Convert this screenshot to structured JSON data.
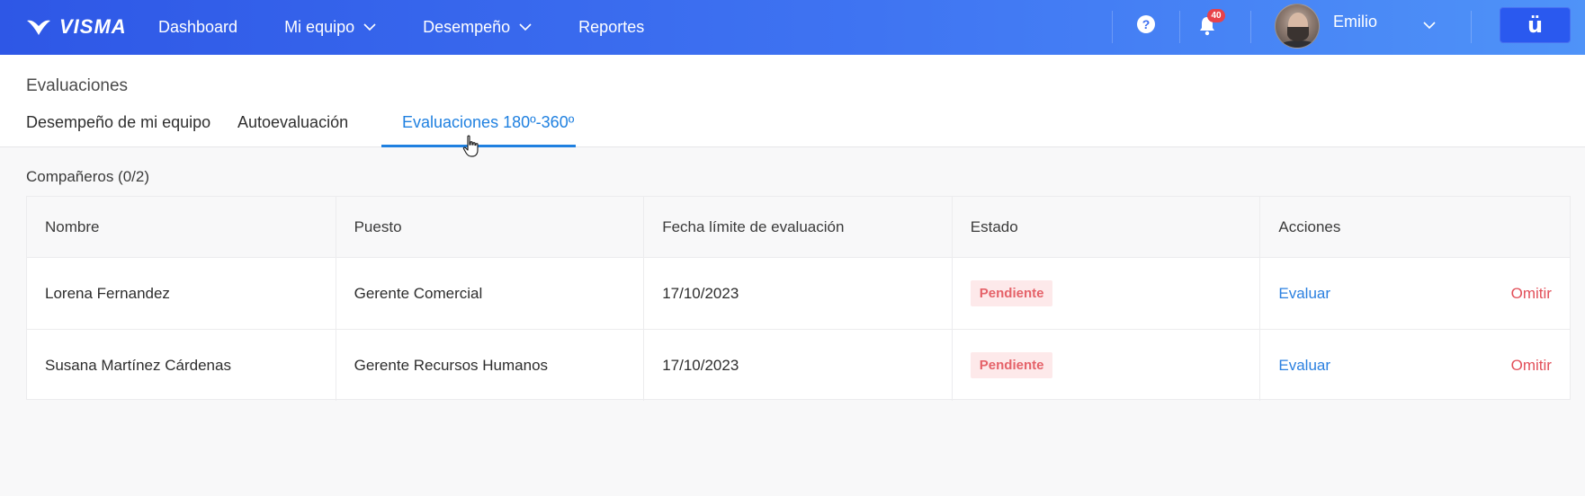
{
  "brand": {
    "name": "VISMA"
  },
  "nav": {
    "items": [
      {
        "label": "Dashboard",
        "has_dropdown": false
      },
      {
        "label": "Mi equipo",
        "has_dropdown": true
      },
      {
        "label": "Desempeño",
        "has_dropdown": true
      },
      {
        "label": "Reportes",
        "has_dropdown": false
      }
    ],
    "help_icon": "?",
    "notifications_count": "40",
    "user_name": "Emilio",
    "app_icon": "ü"
  },
  "page": {
    "title": "Evaluaciones",
    "tabs": [
      {
        "label": "Desempeño de mi equipo",
        "active": false
      },
      {
        "label": "Autoevaluación",
        "active": false
      },
      {
        "label": "Evaluaciones 180º-360º",
        "active": true
      }
    ]
  },
  "section": {
    "title": "Compañeros (0/2)"
  },
  "table": {
    "columns": [
      "Nombre",
      "Puesto",
      "Fecha límite de evaluación",
      "Estado",
      "Acciones"
    ],
    "rows": [
      {
        "name": "Lorena Fernandez",
        "position": "Gerente Comercial",
        "deadline": "17/10/2023",
        "status": "Pendiente",
        "action_primary": "Evaluar",
        "action_secondary": "Omitir"
      },
      {
        "name": "Susana Martínez Cárdenas",
        "position": "Gerente Recursos Humanos",
        "deadline": "17/10/2023",
        "status": "Pendiente",
        "action_primary": "Evaluar",
        "action_secondary": "Omitir"
      }
    ]
  },
  "colors": {
    "accent": "#1f80e0",
    "status_pending_bg": "#fde9ea",
    "status_pending_text": "#e56269",
    "omit": "#e2505a"
  }
}
